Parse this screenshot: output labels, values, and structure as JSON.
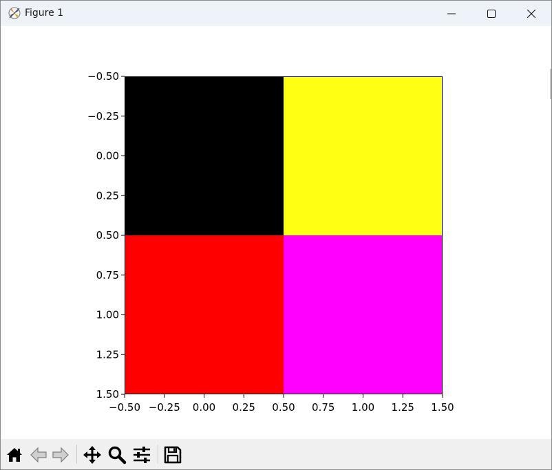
{
  "window": {
    "title": "Figure 1",
    "app_icon": "matplotlib-logo-icon",
    "controls": [
      "minimize-icon",
      "maximize-icon",
      "close-icon"
    ]
  },
  "toolbar": {
    "buttons": [
      {
        "name": "home-button",
        "icon": "home-icon"
      },
      {
        "name": "back-button",
        "icon": "back-arrow-icon"
      },
      {
        "name": "forward-button",
        "icon": "forward-arrow-icon"
      },
      {
        "name": "pan-button",
        "icon": "pan-move-icon"
      },
      {
        "name": "zoom-button",
        "icon": "zoom-magnifier-icon"
      },
      {
        "name": "configure-subplots-button",
        "icon": "sliders-icon"
      },
      {
        "name": "save-button",
        "icon": "floppy-disk-icon"
      }
    ]
  },
  "chart_data": {
    "type": "heatmap",
    "title": "",
    "xlabel": "",
    "ylabel": "",
    "grid": false,
    "y_inverted": true,
    "xlim": [
      -0.5,
      1.5
    ],
    "ylim": [
      1.5,
      -0.5
    ],
    "xticks": [
      "−0.50",
      "−0.25",
      "0.00",
      "0.25",
      "0.50",
      "0.75",
      "1.00",
      "1.25",
      "1.50"
    ],
    "yticks": [
      "−0.50",
      "−0.25",
      "0.00",
      "0.25",
      "0.50",
      "0.75",
      "1.00",
      "1.25",
      "1.50"
    ],
    "xtick_values": [
      -0.5,
      -0.25,
      0,
      0.25,
      0.5,
      0.75,
      1.0,
      1.25,
      1.5
    ],
    "ytick_values": [
      -0.5,
      -0.25,
      0,
      0.25,
      0.5,
      0.75,
      1.0,
      1.25,
      1.5
    ],
    "cells": [
      {
        "row": 0,
        "col": 0,
        "color": "#000000"
      },
      {
        "row": 0,
        "col": 1,
        "color": "#ffff14"
      },
      {
        "row": 1,
        "col": 0,
        "color": "#ff0000"
      },
      {
        "row": 1,
        "col": 1,
        "color": "#ff00ff"
      }
    ]
  }
}
